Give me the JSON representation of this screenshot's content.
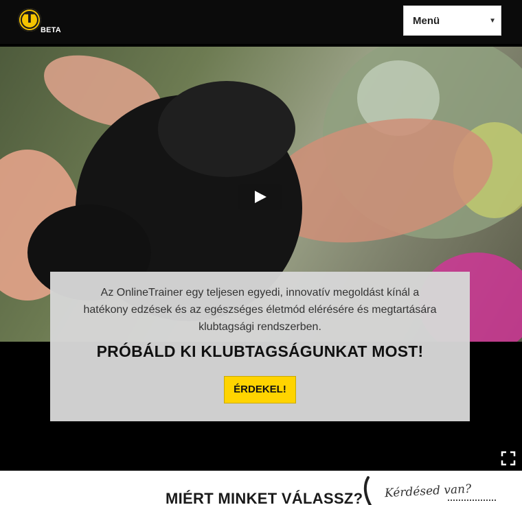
{
  "header": {
    "logo_letter": "T",
    "logo_badge": "BETA",
    "menu_label": "Menü",
    "logo_color": "#f5c400",
    "background": "#0b0b0b"
  },
  "video": {
    "play_icon": "play-icon",
    "fullscreen_icon": "fullscreen-icon"
  },
  "promo": {
    "text": "Az OnlineTrainer egy teljesen egyedi, innovatív megoldást kínál a hatékony edzések és az egészséges életmód elérésére és megtartására klubtagsági rendszerben.",
    "title": "PRÓBÁLD KI KLUBTAGSÁGUNKAT MOST!",
    "button_label": "ÉRDEKEL!",
    "button_color": "#ffd400"
  },
  "bottom": {
    "why_title": "MIÉRT MINKET VÁLASSZ?",
    "question": "Kérdésed van?"
  }
}
